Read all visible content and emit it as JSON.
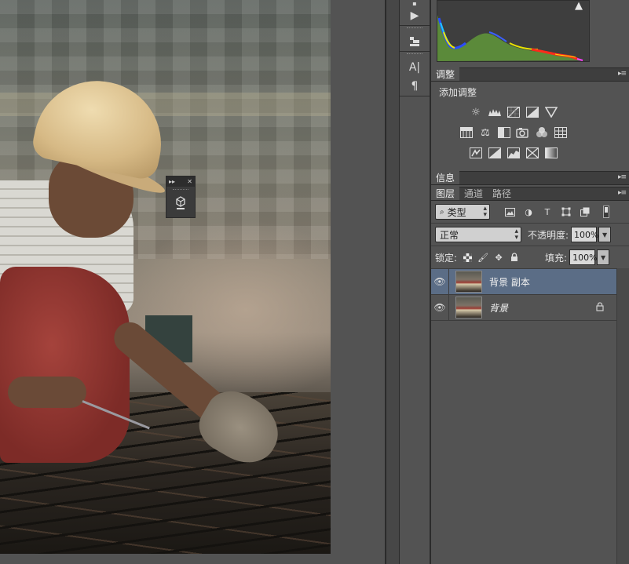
{
  "canvas": {
    "document": "photo of construction worker tying rebar"
  },
  "float_panel": {
    "collapse_glyph": "▸▸",
    "close_glyph": "✕",
    "icon": "3d-cube-icon"
  },
  "tools": [
    {
      "name": "play-icon",
      "glyph": "▶"
    },
    {
      "name": "clone-source-icon",
      "glyph": "▚"
    },
    {
      "name": "character-icon",
      "glyph": "A|"
    },
    {
      "name": "paragraph-icon",
      "glyph": "¶"
    }
  ],
  "histogram": {
    "warning": "▲"
  },
  "adjustments": {
    "tab": "调整",
    "add_label": "添加调整",
    "row1": [
      "brightness-icon",
      "levels-icon",
      "curves-icon",
      "exposure-icon",
      "vibrance-icon"
    ],
    "row2": [
      "hue-saturation-icon",
      "color-balance-icon",
      "black-white-icon",
      "photo-filter-icon",
      "channel-mixer-icon",
      "color-lookup-icon"
    ],
    "row3": [
      "invert-icon",
      "posterize-icon",
      "threshold-icon",
      "selective-color-icon",
      "gradient-map-icon"
    ]
  },
  "info": {
    "tab": "信息"
  },
  "layers_panel": {
    "tabs": [
      "图层",
      "通道",
      "路径"
    ],
    "filter_label": "类型",
    "blend_mode": "正常",
    "opacity_label": "不透明度:",
    "opacity_value": "100%",
    "lock_label": "锁定:",
    "fill_label": "填充:",
    "fill_value": "100%",
    "layers": [
      {
        "name": "背景 副本",
        "selected": true,
        "locked": false
      },
      {
        "name": "背景",
        "selected": false,
        "locked": true
      }
    ]
  },
  "colors": {
    "selected_layer": "#5b6d86",
    "panel_bg": "#535353"
  }
}
